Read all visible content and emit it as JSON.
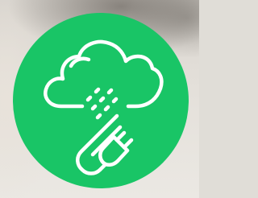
{
  "app_icon": {
    "icon": "cloud-plug-icon",
    "background_color": "#19c566",
    "glyph_color": "#ffffff"
  },
  "backdrop": {
    "description_icon": "blurred-background",
    "color": "#e0ddd7"
  }
}
